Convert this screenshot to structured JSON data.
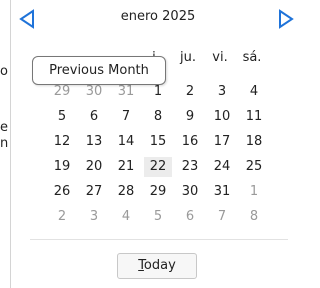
{
  "left_fragments": [
    "o",
    "el",
    "n"
  ],
  "calendar": {
    "month_label": "enero 2025",
    "prev_icon": "triangle-left-icon",
    "next_icon": "triangle-right-icon",
    "accent_color": "#1f73d9",
    "weekdays": [
      "",
      "",
      "",
      "i.",
      "ju.",
      "vi.",
      "sá."
    ],
    "weeks": [
      [
        {
          "d": "29",
          "other": true
        },
        {
          "d": "30",
          "other": true
        },
        {
          "d": "31",
          "other": true
        },
        {
          "d": "1"
        },
        {
          "d": "2"
        },
        {
          "d": "3"
        },
        {
          "d": "4"
        }
      ],
      [
        {
          "d": "5"
        },
        {
          "d": "6"
        },
        {
          "d": "7"
        },
        {
          "d": "8"
        },
        {
          "d": "9"
        },
        {
          "d": "10"
        },
        {
          "d": "11"
        }
      ],
      [
        {
          "d": "12"
        },
        {
          "d": "13"
        },
        {
          "d": "14"
        },
        {
          "d": "15"
        },
        {
          "d": "16"
        },
        {
          "d": "17"
        },
        {
          "d": "18"
        }
      ],
      [
        {
          "d": "19"
        },
        {
          "d": "20"
        },
        {
          "d": "21"
        },
        {
          "d": "22",
          "today": true
        },
        {
          "d": "23"
        },
        {
          "d": "24"
        },
        {
          "d": "25"
        }
      ],
      [
        {
          "d": "26"
        },
        {
          "d": "27"
        },
        {
          "d": "28"
        },
        {
          "d": "29"
        },
        {
          "d": "30"
        },
        {
          "d": "31"
        },
        {
          "d": "1",
          "other": true
        }
      ],
      [
        {
          "d": "2",
          "other": true
        },
        {
          "d": "3",
          "other": true
        },
        {
          "d": "4",
          "other": true
        },
        {
          "d": "5",
          "other": true
        },
        {
          "d": "6",
          "other": true
        },
        {
          "d": "7",
          "other": true
        },
        {
          "d": "8",
          "other": true
        }
      ]
    ],
    "today_button": {
      "accel": "T",
      "rest": "oday"
    }
  },
  "tooltip": "Previous Month"
}
